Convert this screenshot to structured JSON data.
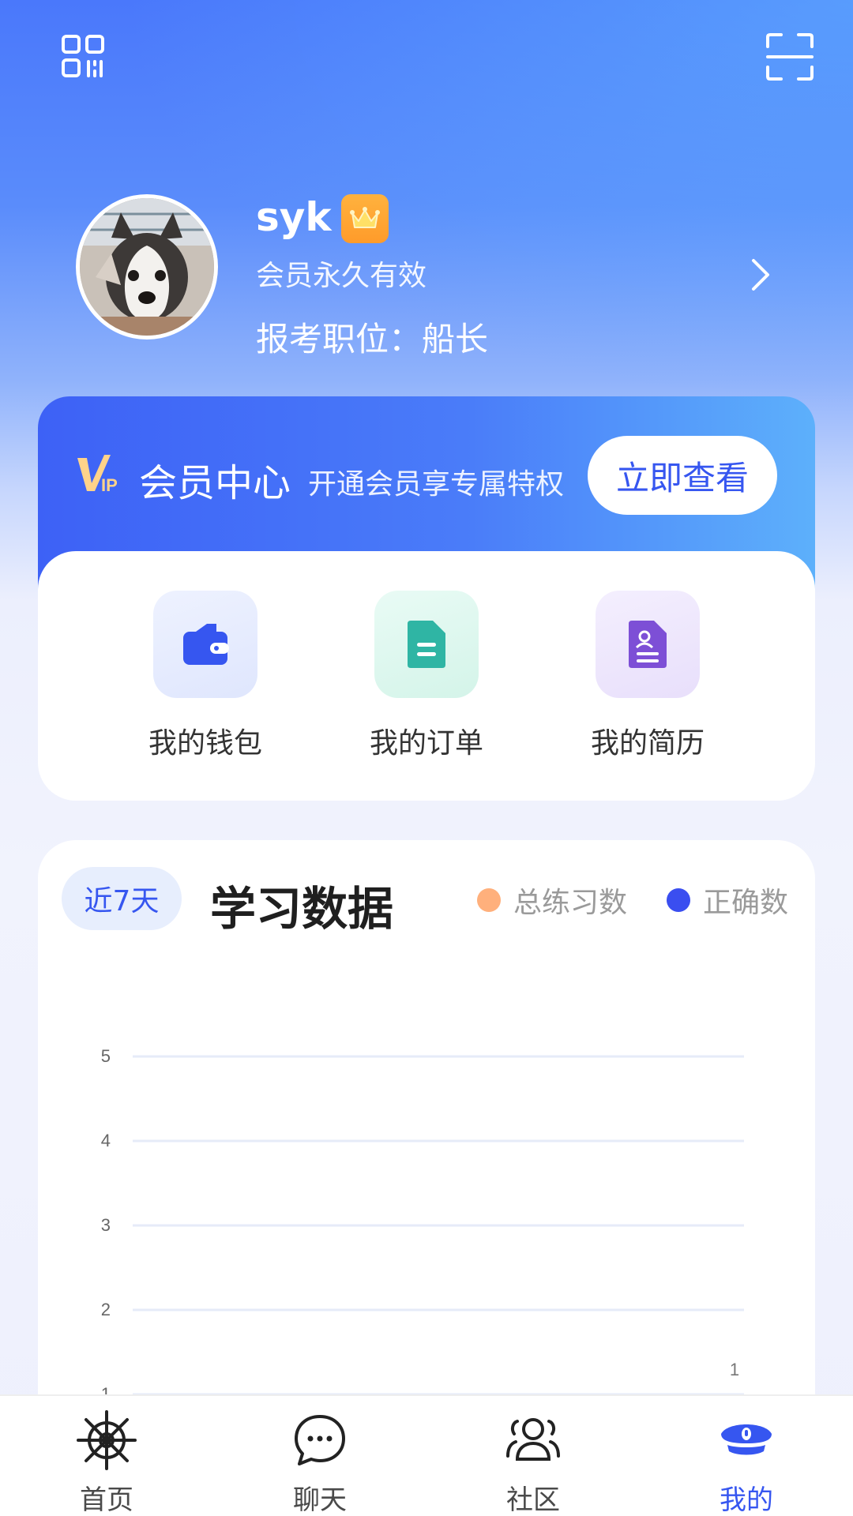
{
  "profile": {
    "username": "syk",
    "member_status": "会员永久有效",
    "job_label": "报考职位：",
    "job_value": "船长"
  },
  "vip": {
    "title": "会员中心",
    "subtitle": "开通会员享专属特权",
    "button_label": "立即查看"
  },
  "quick_actions": [
    {
      "label": "我的钱包",
      "icon": "wallet-icon",
      "color": "#3656f0"
    },
    {
      "label": "我的订单",
      "icon": "document-icon",
      "color": "#2fb5a4"
    },
    {
      "label": "我的简历",
      "icon": "resume-icon",
      "color": "#7d4fd6"
    }
  ],
  "study": {
    "range_label": "近7天",
    "title": "学习数据",
    "legend": [
      {
        "name": "总练习数",
        "color": "#ffb07c"
      },
      {
        "name": "正确数",
        "color": "#3a4ef0"
      }
    ]
  },
  "chart_data": {
    "type": "bar",
    "ylim": [
      0,
      5
    ],
    "yticks": [
      1,
      2,
      3,
      4,
      5
    ],
    "grid": true,
    "series": [
      {
        "name": "总练习数",
        "color": "#ffb07c",
        "last_value": 1
      },
      {
        "name": "正确数",
        "color": "#3a4ef0"
      }
    ],
    "data_labels": [
      "1"
    ]
  },
  "nav": [
    {
      "label": "首页",
      "icon": "ship-wheel-icon",
      "active": false
    },
    {
      "label": "聊天",
      "icon": "chat-bubble-icon",
      "active": false
    },
    {
      "label": "社区",
      "icon": "community-icon",
      "active": false
    },
    {
      "label": "我的",
      "icon": "captain-hat-icon",
      "active": true
    }
  ],
  "colors": {
    "accent": "#3656f0",
    "header_gradient_start": "#4a78fb",
    "header_gradient_end": "#5db0fb"
  }
}
